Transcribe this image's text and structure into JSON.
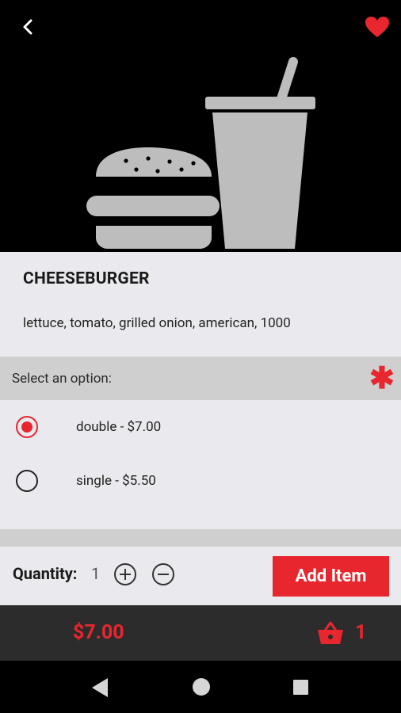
{
  "header": {
    "back_icon": "chevron-left-icon",
    "favorite_icon": "heart-icon",
    "hero_image": "burger-and-drink-illustration",
    "favorite_color": "#e8262e"
  },
  "item": {
    "title": "CHEESEBURGER",
    "description": "lettuce, tomato, grilled onion, american, 1000"
  },
  "option_group": {
    "label": "Select an option:",
    "required_marker": "✱",
    "options": [
      {
        "label": "double - $7.00",
        "selected": true
      },
      {
        "label": "single - $5.50",
        "selected": false
      }
    ]
  },
  "quantity": {
    "label": "Quantity:",
    "value": "1",
    "increment_icon": "plus-circle-icon",
    "decrement_icon": "minus-circle-icon"
  },
  "add_button": {
    "label": "Add Item"
  },
  "cart": {
    "total": "$7.00",
    "icon": "basket-icon",
    "count": "1"
  },
  "theme": {
    "accent": "#e8262e",
    "panel": "#eaeaee",
    "section_header": "#cfcfcf",
    "cart_bar": "#2c2c2c"
  }
}
